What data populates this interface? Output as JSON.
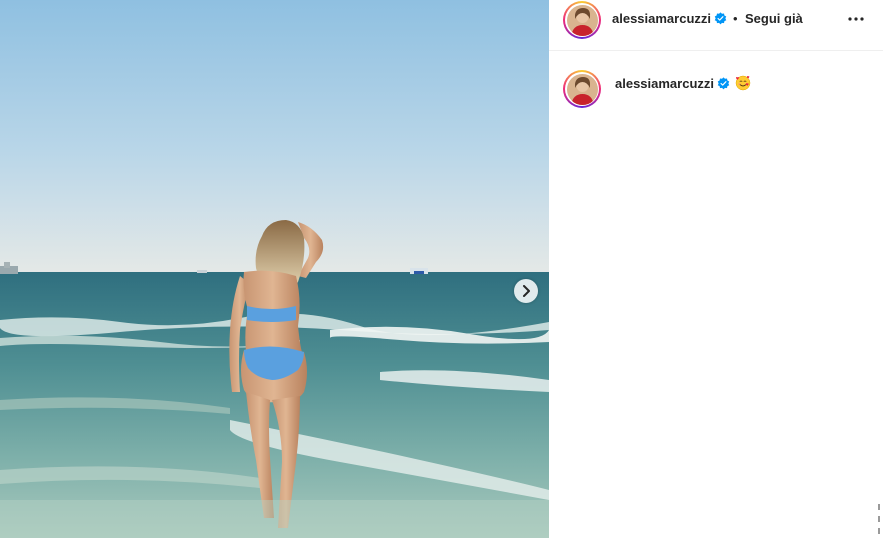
{
  "post": {
    "username": "alessiamarcuzzi",
    "follow_separator": "•",
    "follow_status": "Segui già",
    "caption_emoji": "smiling-face-with-hearts",
    "icons": {
      "verified": "verified-badge-icon",
      "more": "more-options-icon",
      "next": "chevron-right-icon"
    }
  },
  "colors": {
    "verified_blue": "#0095f6",
    "text": "#262626",
    "divider": "#efefef"
  }
}
